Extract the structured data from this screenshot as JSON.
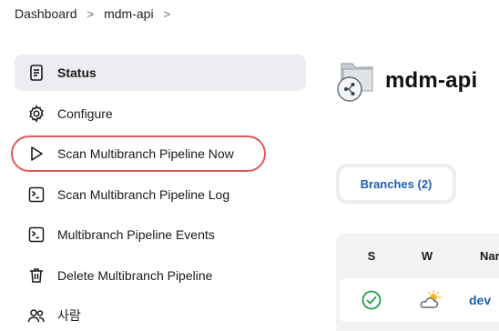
{
  "breadcrumb": {
    "items": [
      "Dashboard",
      "mdm-api"
    ],
    "separator": ">"
  },
  "sidebar": {
    "items": [
      {
        "label": "Status",
        "icon": "document-icon",
        "active": true
      },
      {
        "label": "Configure",
        "icon": "gear-icon"
      },
      {
        "label": "Scan Multibranch Pipeline Now",
        "icon": "play-icon",
        "highlighted": true
      },
      {
        "label": "Scan Multibranch Pipeline Log",
        "icon": "terminal-icon"
      },
      {
        "label": "Multibranch Pipeline Events",
        "icon": "terminal-icon"
      },
      {
        "label": "Delete Multibranch Pipeline",
        "icon": "trash-icon"
      },
      {
        "label": "사람",
        "icon": "people-icon"
      }
    ]
  },
  "project": {
    "title": "mdm-api",
    "icon": "multibranch-folder-icon"
  },
  "tabs": [
    {
      "label": "Branches (2)",
      "active": true
    }
  ],
  "table": {
    "columns": [
      "S",
      "W",
      "Nar"
    ],
    "rows": [
      {
        "status": "success-check-icon",
        "weather": "partly-cloudy-icon",
        "name": "dev"
      }
    ]
  },
  "colors": {
    "accent": "#1a5fb4",
    "highlight": "#e05a5a",
    "active_bg": "#ebedf0",
    "success": "#1e9e4a"
  }
}
